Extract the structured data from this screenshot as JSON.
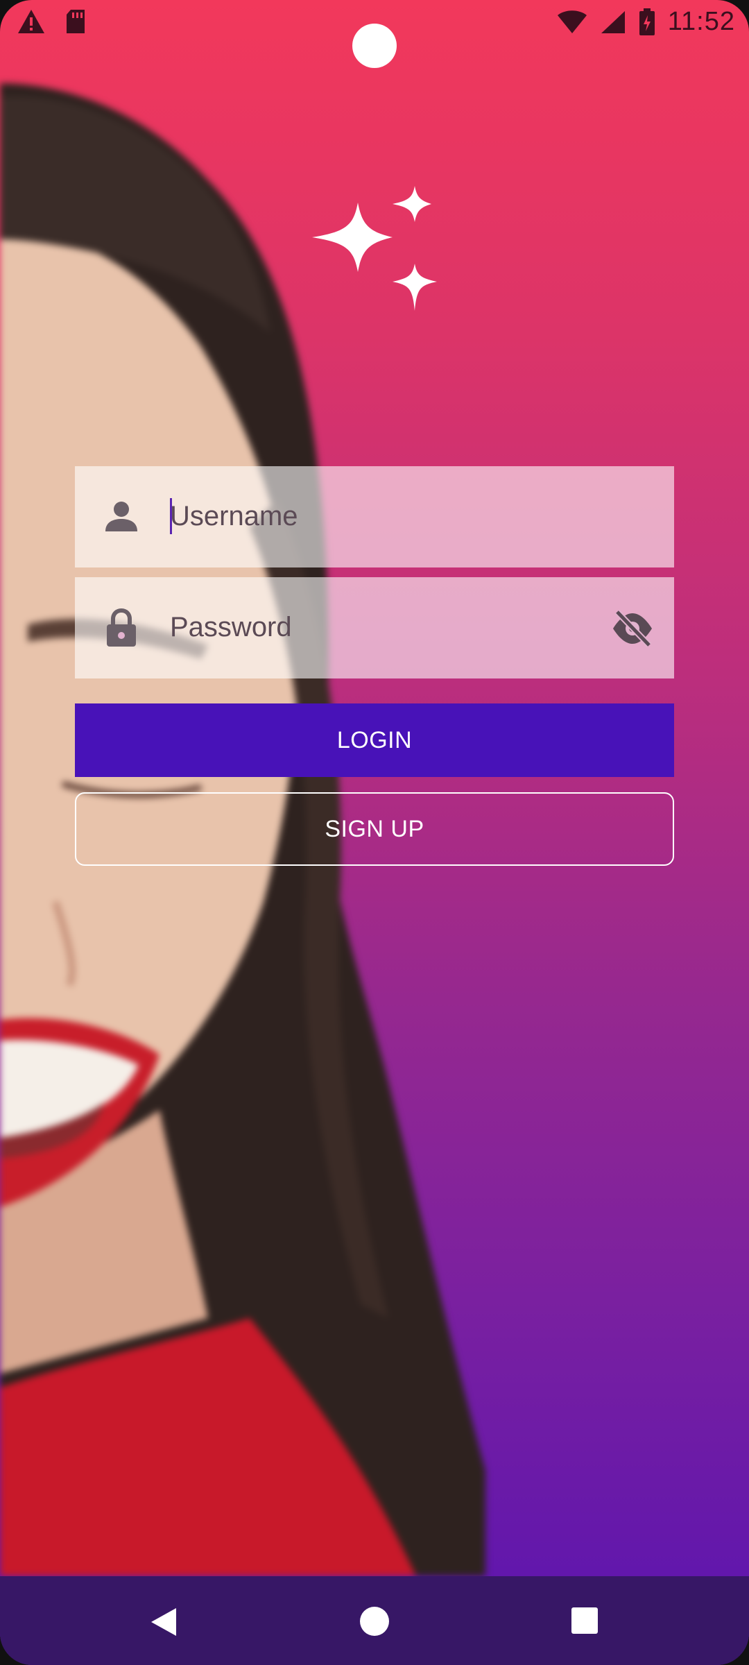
{
  "status_bar": {
    "time": "11:52",
    "icons": [
      "alert-icon",
      "sd-card-icon",
      "wifi-icon",
      "signal-icon",
      "battery-charging-icon"
    ]
  },
  "logo": {
    "icon": "sparkles-icon"
  },
  "form": {
    "username": {
      "placeholder": "Username",
      "icon": "person-icon"
    },
    "password": {
      "placeholder": "Password",
      "icon": "lock-icon",
      "toggle_icon": "eye-off-icon"
    },
    "login_label": "LOGIN",
    "signup_label": "SIGN UP"
  },
  "nav_bar": {
    "buttons": [
      "back-icon",
      "home-icon",
      "recents-icon"
    ]
  },
  "colors": {
    "gradient_top": "#f2385b",
    "gradient_bottom": "#5a14b0",
    "login_button": "#4812b8",
    "nav_bar": "#371766"
  }
}
